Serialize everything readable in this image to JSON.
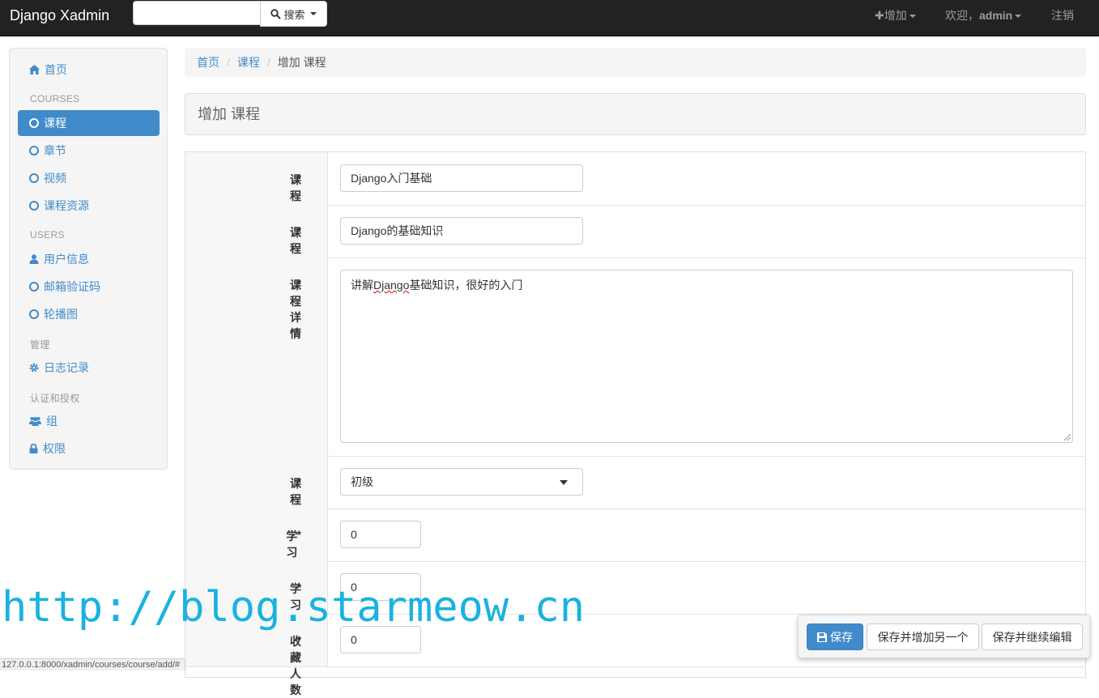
{
  "navbar": {
    "brand": "Django Xadmin",
    "search_placeholder": "",
    "search_button": "搜索",
    "add_label": "增加",
    "welcome_prefix": "欢迎，",
    "username": "admin",
    "logout": "注销"
  },
  "sidebar": {
    "home": "首页",
    "sections": [
      {
        "header": "COURSES",
        "items": [
          "课程",
          "章节",
          "视频",
          "课程资源"
        ]
      },
      {
        "header": "USERS",
        "items": [
          "用户信息",
          "邮箱验证码",
          "轮播图"
        ]
      },
      {
        "header": "管理",
        "items": [
          "日志记录"
        ]
      },
      {
        "header": "认证和授权",
        "items": [
          "组",
          "权限"
        ]
      }
    ]
  },
  "breadcrumb": [
    "首页",
    "课程",
    "增加 课程"
  ],
  "page_title": "增加 课程",
  "form": {
    "fields": [
      {
        "label": "课程名",
        "value": "Django入门基础"
      },
      {
        "label": "课程描述",
        "value": "Django的基础知识"
      },
      {
        "label": "课程详情",
        "value_before": "讲解",
        "value_spell": "Django",
        "value_after": "基础知识，很好的入门"
      },
      {
        "label": "课程难度",
        "value": "初级"
      },
      {
        "label": "学习时长(分钟数)",
        "value": "0"
      },
      {
        "label": "学习人数",
        "value": "0"
      },
      {
        "label": "收藏人数",
        "value": "0"
      }
    ],
    "required_mark": "*"
  },
  "actions": {
    "save": "保存",
    "save_add_another": "保存并增加另一个",
    "save_continue": "保存并继续编辑"
  },
  "watermark": "http://blog.starmeow.cn",
  "status_url": "127.0.0.1:8000/xadmin/courses/course/add/#"
}
